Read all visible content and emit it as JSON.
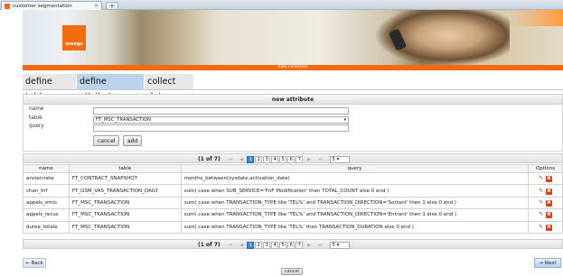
{
  "browser": {
    "tab_title": "customer segmentation",
    "close_glyph": "×",
    "new_tab_glyph": "+"
  },
  "brand": {
    "logo_text": "orange",
    "accent": "#f26b10"
  },
  "section_title": "data collection",
  "nav": {
    "tabs": [
      {
        "label": "define tables",
        "active": false
      },
      {
        "label": "define attributes",
        "active": true
      },
      {
        "label": "collect data",
        "active": false
      }
    ]
  },
  "new_attribute": {
    "header": "new attribute",
    "name_label": "name",
    "table_label": "table",
    "query_label": "query",
    "name_value": "",
    "table_value": "FT_MSC_TRANSACTION",
    "query_value": "",
    "cancel_label": "cancel",
    "add_label": "add",
    "dropdown_glyph": "▾"
  },
  "pager": {
    "count": "(1 of 7)",
    "first": "⏮",
    "prev": "◀",
    "next": "▶",
    "last": "⏭",
    "pages": [
      "1",
      "2",
      "3",
      "4",
      "5",
      "6",
      "7"
    ],
    "current_page": "1",
    "page_size": "5",
    "page_size_glyph": "▾"
  },
  "table": {
    "columns": [
      "name",
      "table",
      "query",
      "Options"
    ],
    "rows": [
      {
        "name": "anciennete",
        "table": "FT_CONTRACT_SNAPSHOT",
        "query": "months_between(sysdate,activation_date)"
      },
      {
        "name": "chan_fnf",
        "table": "FT_GSM_VAS_TRANSACTION_DAILY",
        "query": "sum( case when SUB_SERVICE='FnF Modification' then TOTAL_COUNT else 0 end )"
      },
      {
        "name": "appels_emis",
        "table": "FT_MSC_TRANSACTION",
        "query": "sum( case when TRANSACTION_TYPE like 'TEL%' and TRANSACTION_DIRECTION='Sortant' then 1 else 0 end )"
      },
      {
        "name": "appels_recus",
        "table": "FT_MSC_TRANSACTION",
        "query": "sum( case when TRANSACTION_TYPE like 'TEL%' and TRANSACTION_DIRECTION='Entrant' then 1 else 0 end )"
      },
      {
        "name": "duree_totale",
        "table": "FT_MSC_TRANSACTION",
        "query": "sum( case when TRANSACTION_TYPE like 'TEL%' then TRANSACTION_DURATION else 0 end )"
      }
    ],
    "edit_icon": "✎",
    "delete_icon": "✖"
  },
  "footer": {
    "back_label": "← Back",
    "next_label": "→ Next",
    "cancel_label": "cancel"
  }
}
